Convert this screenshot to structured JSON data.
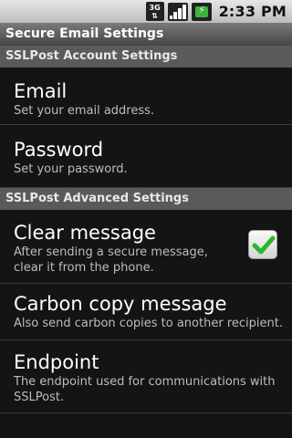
{
  "status": {
    "network_label_top": "3G",
    "network_label_bottom": "⇅",
    "time": "2:33 PM"
  },
  "header": {
    "title": "Secure Email Settings"
  },
  "sections": [
    {
      "title": "SSLPost Account Settings",
      "items": [
        {
          "title": "Email",
          "summary": "Set your email address."
        },
        {
          "title": "Password",
          "summary": "Set your password."
        }
      ]
    },
    {
      "title": "SSLPost Advanced Settings",
      "items": [
        {
          "title": "Clear message",
          "summary": "After sending a secure message, clear it from the phone.",
          "checked": true
        },
        {
          "title": "Carbon copy message",
          "summary": "Also send carbon copies to another recipient."
        },
        {
          "title": "Endpoint",
          "summary": "The endpoint used for communications with SSLPost."
        }
      ]
    }
  ],
  "colors": {
    "accent_check": "#2db52d",
    "category_bg": "#5a5a5a",
    "background": "#141414"
  }
}
